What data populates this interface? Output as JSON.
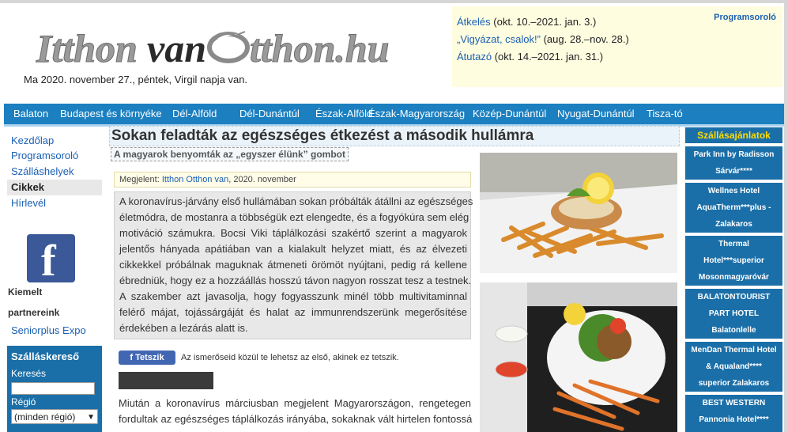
{
  "header": {
    "logo_text": "Itthonvan Otthon.hu",
    "date_line": "Ma 2020. november 27., péntek, Virgil napja van.",
    "events_link": "Programsoroló",
    "events": [
      {
        "link": "Átkelés",
        "text": "(okt. 10.–2021. jan.  3.)"
      },
      {
        "link": "„Vigyázat, csalok!”",
        "text": "(aug. 28.–nov. 28.)"
      },
      {
        "link": "Átutazó",
        "text": "(okt. 14.–2021. jan. 31.)"
      }
    ]
  },
  "nav": [
    "Balaton",
    "Budapest és környéke",
    "Dél-Alföld",
    "Dél-Dunántúl",
    "Észak-Alföld",
    "Észak-Magyarország",
    "Közép-Dunántúl",
    "Nyugat-Dunántúl",
    "Tisza-tó"
  ],
  "left_menu": [
    "Kezdőlap",
    "Programsoroló",
    "Szálláshelyek",
    "Cikkek",
    "Hírlevél"
  ],
  "partners": {
    "line1": "Kiemelt",
    "line2": "partnereink",
    "item": "Seniorplus Expo"
  },
  "search": {
    "title": "Szálláskereső",
    "keyword_label": "Keresés",
    "region_label": "Régió",
    "region_value": "(minden régió)"
  },
  "article": {
    "title": "Sokan feladták az egészséges étkezést a második hullámra",
    "lead": "A magyarok benyomták az „egyszer élünk” gombot",
    "meta_prefix": "Megjelent:",
    "meta_author": "Itthon Otthon van",
    "meta_date": ", 2020. november",
    "body_lines": [
      "A koronavírus-járvány első hullámában sokan próbálták átállni az egészséges",
      "életmódra, de mostanra a többségük ezt elengedte, és a fogyókúra sem elég",
      "motiváció számukra. Bocsi Viki táplálkozási szakértő szerint a magyarok",
      "jelentős hányada apátiában van a kialakult helyzet miatt, és az élvezeti",
      "cikkekkel próbálnak maguknak átmeneti örömöt nyújtani, pedig rá kellene",
      "ébredniük, hogy ez a hozzáállás hosszú távon nagyon rosszat tesz a testnek.",
      "A szakember azt javasolja, hogy fogyasszunk minél több multivitaminnal",
      "felérő májat, tojássárgáját és halat az immunrendszerünk megerősítése",
      "érdekében a lezárás alatt is."
    ],
    "like_button": "Tetszik",
    "like_text": "Az ismerőseid közül te lehetsz az első, akinek ez tetszik.",
    "p2_lines": [
      "Miután a koronavírus márciusban megjelent Magyarországon, rengetegen",
      "fordultak az egészséges táplálkozás irányába, sokaknak vált hirtelen fontossá"
    ]
  },
  "right": {
    "header": "Szállásajánlatok",
    "offers": [
      [
        "Park Inn by Radisson",
        "Sárvár****"
      ],
      [
        "Wellnes Hotel",
        "AquaTherm***plus -",
        "Zalakaros"
      ],
      [
        "Thermal",
        "Hotel***superior",
        "Mosonmagyaróvár"
      ],
      [
        "BALATONTOURIST",
        "PART HOTEL",
        "Balatonlelle"
      ],
      [
        "MenDan Thermal Hotel",
        "& Aqualand****",
        "superior Zalakaros"
      ],
      [
        "BEST WESTERN",
        "Pannonia Hotel****"
      ]
    ]
  }
}
